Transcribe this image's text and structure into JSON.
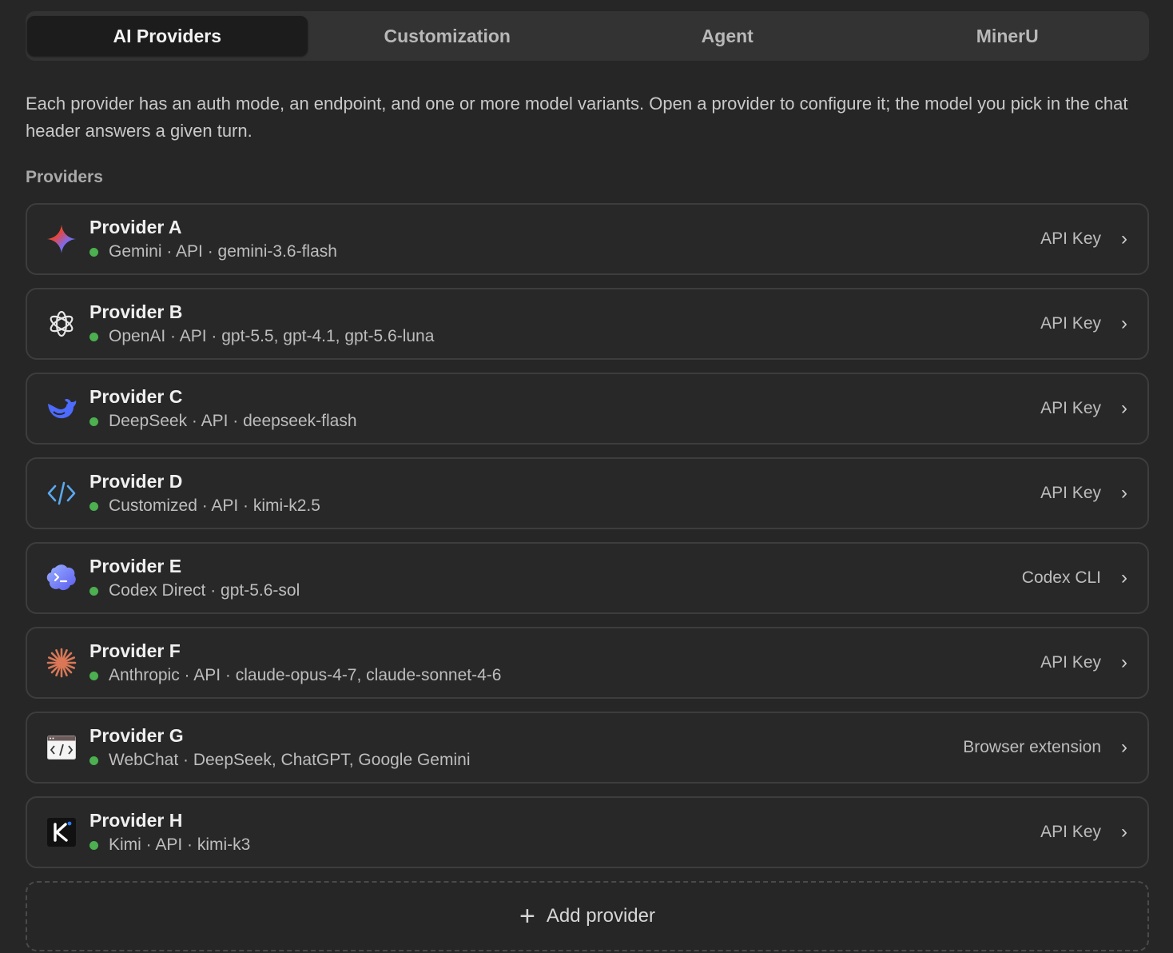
{
  "tabs": [
    {
      "label": "AI Providers",
      "active": true
    },
    {
      "label": "Customization",
      "active": false
    },
    {
      "label": "Agent",
      "active": false
    },
    {
      "label": "MinerU",
      "active": false
    }
  ],
  "description": "Each provider has an auth mode, an endpoint, and one or more model variants. Open a provider to configure it; the model you pick in the chat header answers a given turn.",
  "section_label": "Providers",
  "status_color": "#4caf50",
  "providers": [
    {
      "name": "Provider A",
      "subtitle": "Gemini · API · gemini-3.6-flash",
      "auth": "API Key",
      "icon": "gemini-sparkle-icon",
      "status": "connected"
    },
    {
      "name": "Provider B",
      "subtitle": "OpenAI · API · gpt-5.5, gpt-4.1, gpt-5.6-luna",
      "auth": "API Key",
      "icon": "openai-logo-icon",
      "status": "connected"
    },
    {
      "name": "Provider C",
      "subtitle": "DeepSeek · API · deepseek-flash",
      "auth": "API Key",
      "icon": "deepseek-whale-icon",
      "status": "connected"
    },
    {
      "name": "Provider D",
      "subtitle": "Customized · API · kimi-k2.5",
      "auth": "API Key",
      "icon": "code-brackets-icon",
      "status": "connected"
    },
    {
      "name": "Provider E",
      "subtitle": "Codex Direct · gpt-5.6-sol",
      "auth": "Codex CLI",
      "icon": "codex-cloud-icon",
      "status": "connected"
    },
    {
      "name": "Provider F",
      "subtitle": "Anthropic · API · claude-opus-4-7, claude-sonnet-4-6",
      "auth": "API Key",
      "icon": "anthropic-starburst-icon",
      "status": "connected"
    },
    {
      "name": "Provider G",
      "subtitle": "WebChat · DeepSeek, ChatGPT, Google Gemini",
      "auth": "Browser extension",
      "icon": "browser-code-window-icon",
      "status": "connected"
    },
    {
      "name": "Provider H",
      "subtitle": "Kimi · API · kimi-k3",
      "auth": "API Key",
      "icon": "kimi-k-icon",
      "status": "connected"
    }
  ],
  "add_provider_label": "Add provider"
}
